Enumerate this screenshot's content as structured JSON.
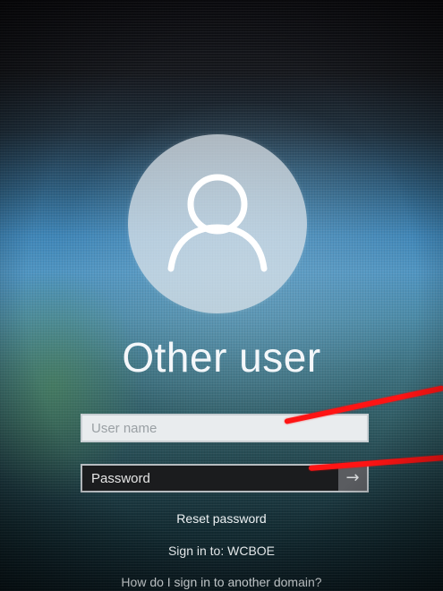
{
  "login": {
    "title": "Other user",
    "username_placeholder": "User name",
    "password_placeholder": "Password",
    "submit_icon": "arrow-right-icon",
    "reset_password": "Reset password",
    "sign_in_to": "Sign in to: WCBOE",
    "other_domain": "How do I sign in to another domain?"
  },
  "annotations": {
    "color": "#ff1414",
    "arrow_count": 2
  },
  "colors": {
    "avatar_bg": "#e1e6eb",
    "username_field_bg": "#e9ecee",
    "password_field_bg": "#1b1c1e",
    "submit_button_bg": "#5a5c60"
  }
}
